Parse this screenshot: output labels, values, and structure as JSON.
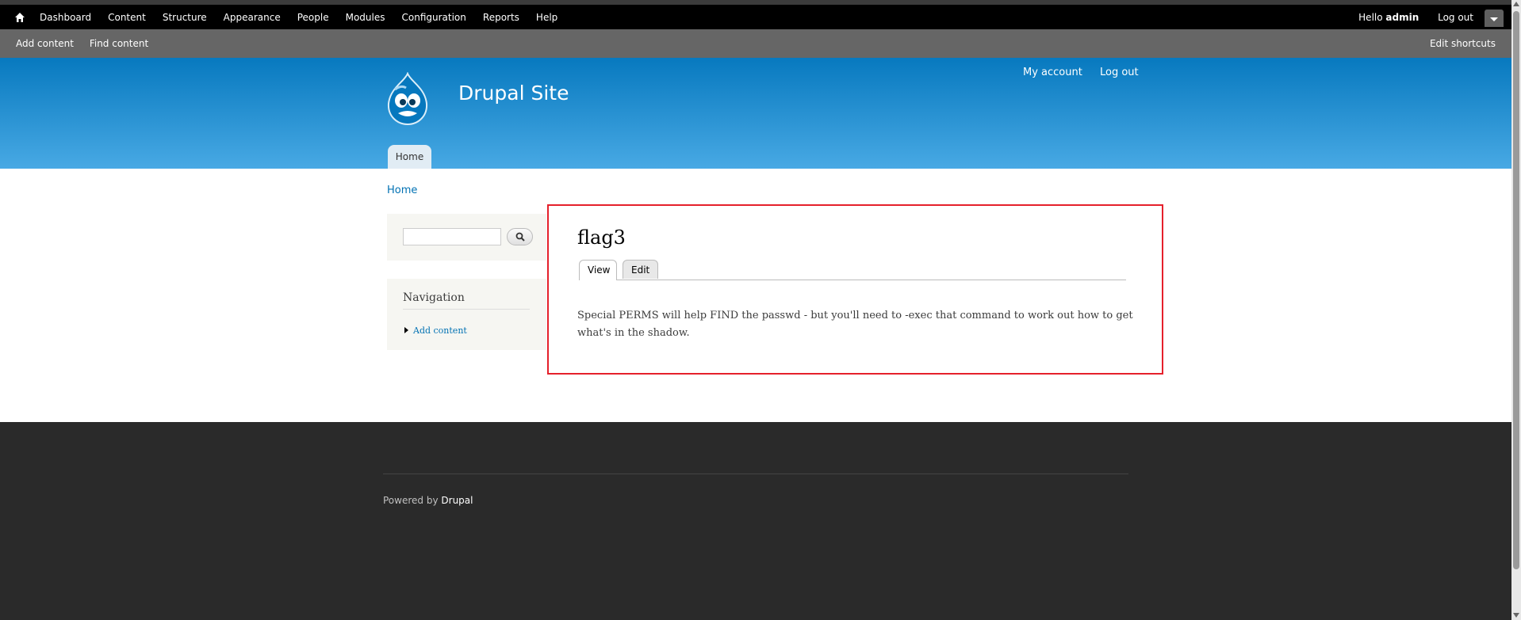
{
  "toolbar": {
    "menu": [
      "Dashboard",
      "Content",
      "Structure",
      "Appearance",
      "People",
      "Modules",
      "Configuration",
      "Reports",
      "Help"
    ],
    "hello": "Hello",
    "username": "admin",
    "logout": "Log out"
  },
  "shortcuts": {
    "items": [
      "Add content",
      "Find content"
    ],
    "edit": "Edit shortcuts"
  },
  "header": {
    "site_name": "Drupal Site",
    "secondary_menu": [
      "My account",
      "Log out"
    ],
    "main_tab": "Home"
  },
  "breadcrumb": "Home",
  "sidebar": {
    "navigation_title": "Navigation",
    "nav_items": [
      "Add content"
    ]
  },
  "node": {
    "title": "flag3",
    "tabs": [
      "View",
      "Edit"
    ],
    "body": "Special PERMS will help FIND the passwd - but you'll need to -exec that command to work out how to get what's in the shadow."
  },
  "footer": {
    "powered_by": "Powered by",
    "link": "Drupal"
  },
  "colors": {
    "header_top": "#0779bf",
    "header_bottom": "#48a9e4",
    "link": "#0071b3",
    "highlight_border": "#e5202b"
  }
}
